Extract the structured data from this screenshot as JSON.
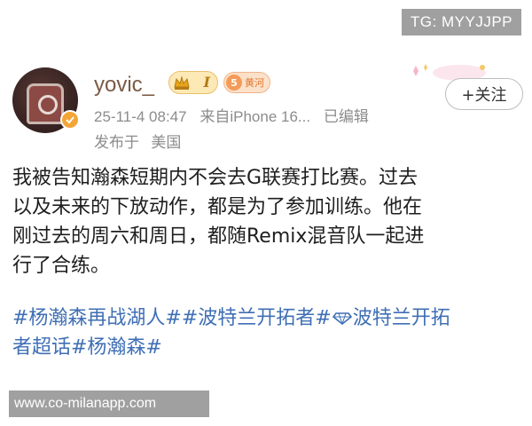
{
  "watermarks": {
    "top_right": "TG: MYYJJPP",
    "bottom_left": "www.co-milanapp.com"
  },
  "post": {
    "author": {
      "username": "yovic_",
      "vip_level": "I",
      "fan_badge_level": "5",
      "fan_badge_text": "黄河",
      "avatar_icon": "basketball-jersey-avatar",
      "verified_icon": "verified-badge-icon"
    },
    "meta": {
      "timestamp": "25-11-4 08:47",
      "source": "来自iPhone 16...",
      "edited": "已编辑",
      "location_prefix": "发布于",
      "location": "美国"
    },
    "follow_label": "+关注",
    "body_lines": [
      "我被告知瀚森短期内不会去G联赛打比赛。过去",
      "以及未来的下放动作，都是为了参加训练。他在",
      "刚过去的周六和周日，都随Remix混音队一起进",
      "行了合练。"
    ],
    "hashtags": {
      "line1_a": "#杨瀚森再战湖人##波特兰开拓者#",
      "line1_b": "波特兰开拓",
      "line2": "者超话#杨瀚森#"
    },
    "colors": {
      "hashtag": "#3f6fb5",
      "username": "#7a5a44",
      "meta": "#8c8c8c",
      "vip_gold": "#e8c06a",
      "fan_badge": "#f49b5a"
    }
  }
}
